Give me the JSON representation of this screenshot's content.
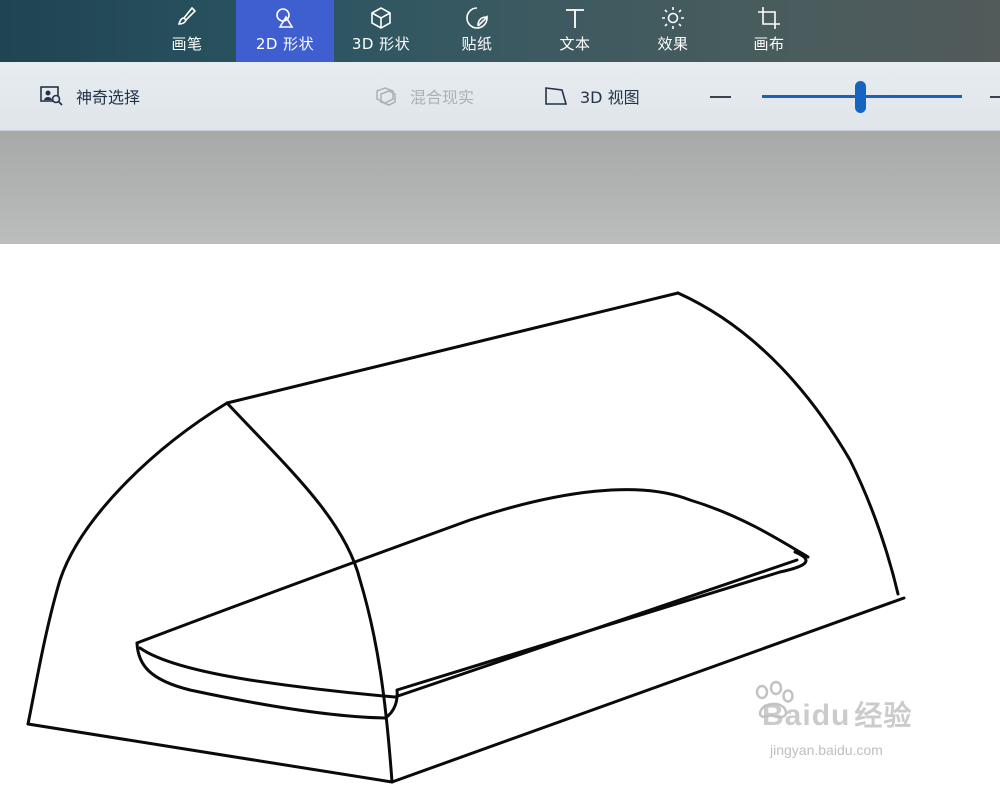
{
  "ribbon": {
    "tabs": [
      {
        "label": "画笔",
        "icon": "brush-icon",
        "active": false
      },
      {
        "label": "2D 形状",
        "icon": "shapes-2d-icon",
        "active": true
      },
      {
        "label": "3D 形状",
        "icon": "cube-3d-icon",
        "active": false
      },
      {
        "label": "贴纸",
        "icon": "sticker-icon",
        "active": false
      },
      {
        "label": "文本",
        "icon": "text-icon",
        "active": false
      },
      {
        "label": "效果",
        "icon": "effects-sun-icon",
        "active": false
      },
      {
        "label": "画布",
        "icon": "canvas-crop-icon",
        "active": false
      }
    ],
    "active_color": "#3f5fd0"
  },
  "toolbar": {
    "magic_select": {
      "label": "神奇选择",
      "icon": "magic-select-icon"
    },
    "mixed_reality": {
      "label": "混合现实",
      "icon": "mixed-reality-icon",
      "disabled": true
    },
    "view_3d": {
      "label": "3D 视图",
      "icon": "view-3d-icon"
    },
    "zoom_icons": [
      "zoom-out-minus-icon",
      "zoom-in-plus-icon"
    ]
  },
  "watermark": {
    "brand": "Bai",
    "brand_suffix": "du",
    "brand_cn": "经验",
    "url": "jingyan.baidu.com"
  },
  "colors": {
    "accent": "#3f5fd0",
    "slider": "#1464c0",
    "ribbon_bg": "#2b5562",
    "toolbar_bg": "#e2e8ec",
    "workspace_bg": "#b0b2b1"
  }
}
